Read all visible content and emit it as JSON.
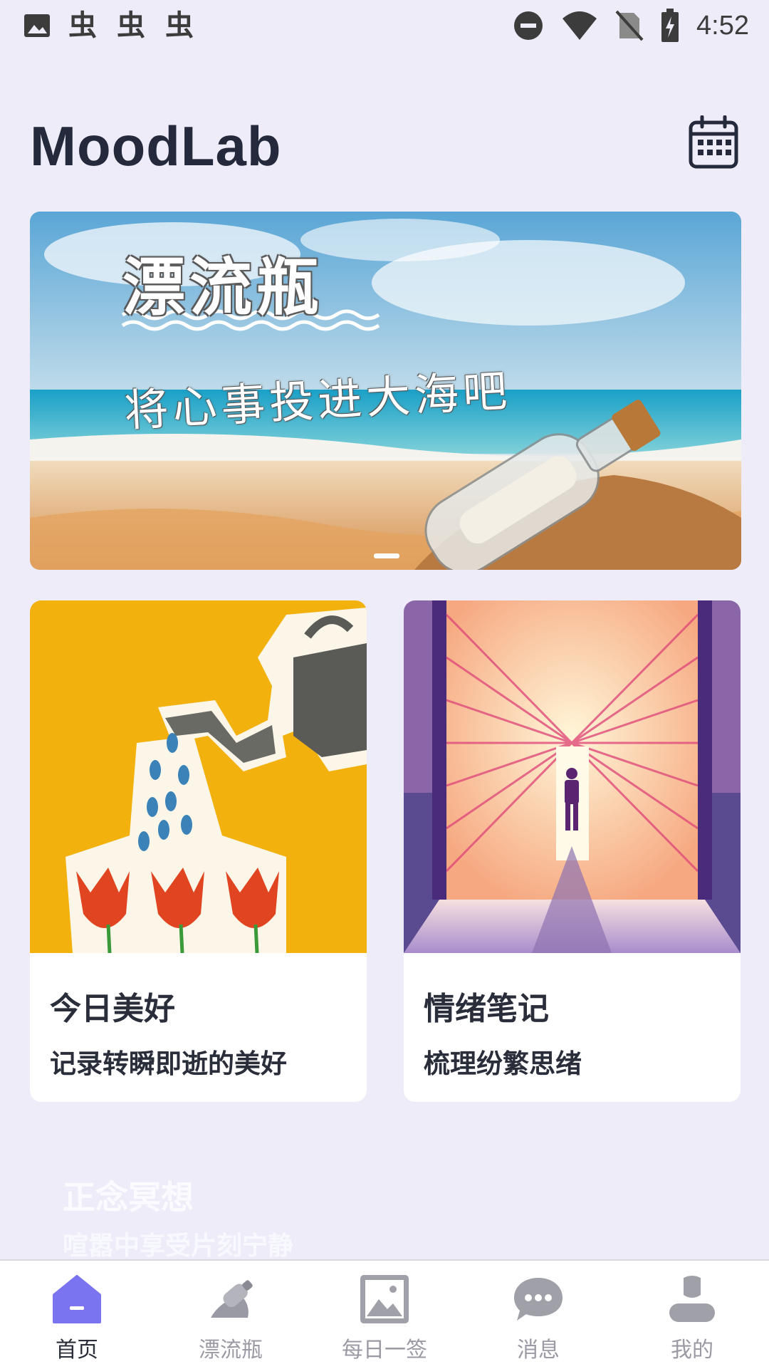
{
  "status_bar": {
    "time": "4:52",
    "left_icons": [
      "image-icon",
      "bug-icon",
      "bug-icon",
      "bug-icon"
    ],
    "right_icons": [
      "do-not-disturb-icon",
      "wifi-icon",
      "no-sim-icon",
      "battery-charging-icon"
    ]
  },
  "header": {
    "title": "MoodLab"
  },
  "banner": {
    "title": "漂流瓶",
    "subtitle": "将心事投进大海吧"
  },
  "cards": [
    {
      "title": "今日美好",
      "desc": "记录转瞬即逝的美好"
    },
    {
      "title": "情绪笔记",
      "desc": "梳理纷繁思绪"
    }
  ],
  "next_section": {
    "title": "正念冥想",
    "desc": "喧嚣中享受片刻宁静"
  },
  "nav": {
    "items": [
      {
        "label": "首页",
        "icon": "home-icon",
        "active": true
      },
      {
        "label": "漂流瓶",
        "icon": "bottle-icon",
        "active": false
      },
      {
        "label": "每日一签",
        "icon": "picture-icon",
        "active": false
      },
      {
        "label": "消息",
        "icon": "chat-icon",
        "active": false
      },
      {
        "label": "我的",
        "icon": "user-icon",
        "active": false
      }
    ]
  },
  "colors": {
    "background": "#eeecf8",
    "accent": "#7b74f0",
    "text": "#2a2d3a",
    "inactive": "#9a9aa4"
  }
}
